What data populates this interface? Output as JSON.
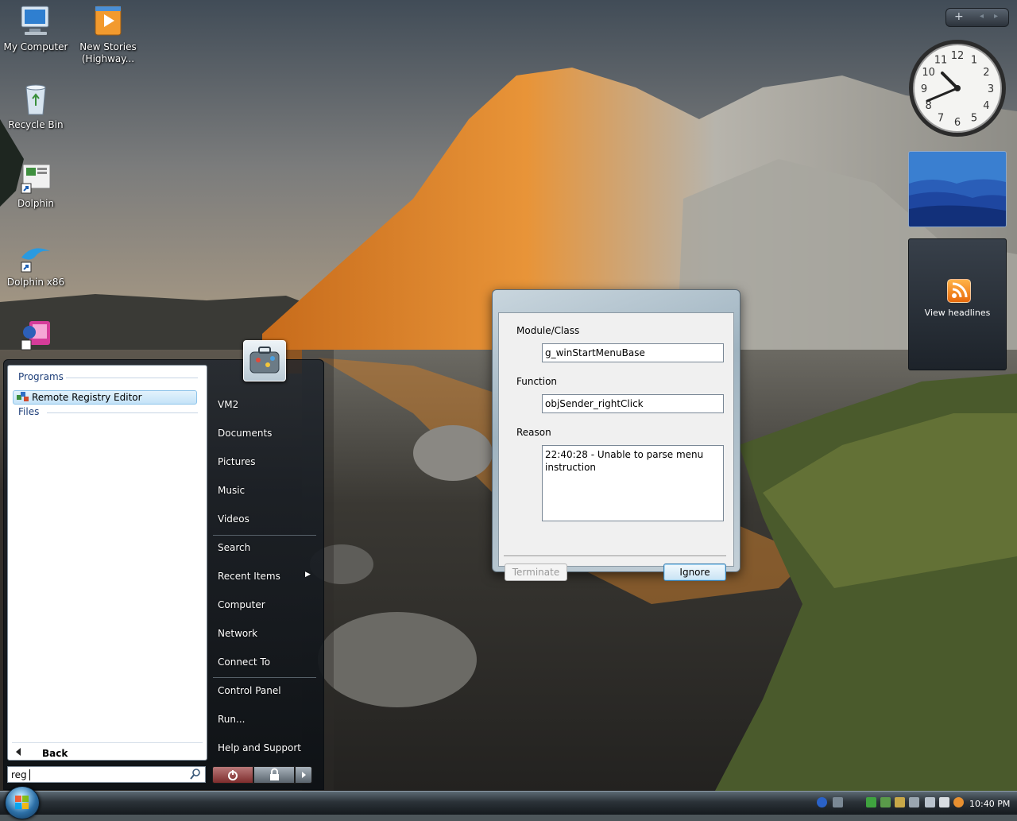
{
  "desktop": {
    "icons": [
      {
        "label": "My Computer"
      },
      {
        "label": "New Stories (Highway..."
      },
      {
        "label": "Recycle Bin"
      },
      {
        "label": "Dolphin"
      },
      {
        "label": "Dolphin x86"
      },
      {
        "label": ""
      }
    ]
  },
  "gadgets": {
    "feed_label": "View headlines",
    "clock_numbers": [
      "12",
      "1",
      "2",
      "3",
      "4",
      "5",
      "6",
      "7",
      "8",
      "9",
      "10",
      "11"
    ]
  },
  "dialog": {
    "module_label": "Module/Class",
    "module_value": "g_winStartMenuBase",
    "function_label": "Function",
    "function_value": "objSender_rightClick",
    "reason_label": "Reason",
    "reason_value": "22:40:28 - Unable to parse menu instruction",
    "terminate_label": "Terminate",
    "ignore_label": "Ignore"
  },
  "start_menu": {
    "programs_header": "Programs",
    "files_header": "Files",
    "result_item": "Remote Registry Editor",
    "back_label": "Back",
    "search_value": "reg",
    "right_links": {
      "user": "VM2",
      "documents": "Documents",
      "pictures": "Pictures",
      "music": "Music",
      "videos": "Videos",
      "search": "Search",
      "recent": "Recent Items",
      "computer": "Computer",
      "network": "Network",
      "connect": "Connect To",
      "control_panel": "Control Panel",
      "run": "Run...",
      "help": "Help and Support"
    }
  },
  "taskbar": {
    "time": "10:40 PM"
  }
}
